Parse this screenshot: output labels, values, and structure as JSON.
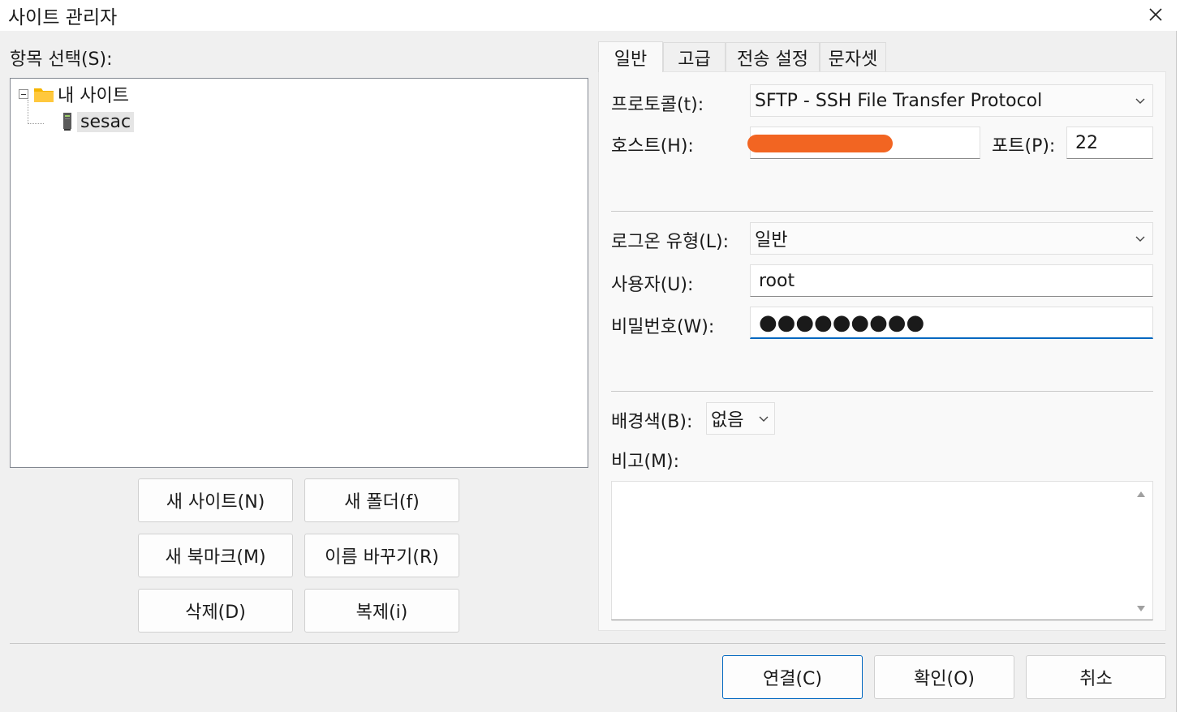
{
  "window": {
    "title": "사이트 관리자"
  },
  "left": {
    "section_label": "항목 선택(S):",
    "tree": {
      "root_label": "내 사이트",
      "children": [
        "sesac"
      ]
    },
    "buttons": {
      "new_site": "새 사이트(N)",
      "new_folder": "새 폴더(f)",
      "new_bookmark": "새 북마크(M)",
      "rename": "이름 바꾸기(R)",
      "delete": "삭제(D)",
      "duplicate": "복제(i)"
    }
  },
  "tabs": [
    "일반",
    "고급",
    "전송 설정",
    "문자셋"
  ],
  "active_tab": "일반",
  "general": {
    "protocol_label": "프로토콜(t):",
    "protocol_value": "SFTP - SSH File Transfer Protocol",
    "host_label": "호스트(H):",
    "host_value": "",
    "port_label": "포트(P):",
    "port_value": "22",
    "logon_type_label": "로그온 유형(L):",
    "logon_type_value": "일반",
    "user_label": "사용자(U):",
    "user_value": "root",
    "password_label": "비밀번호(W):",
    "password_mask": "●●●●●●●●●",
    "bg_color_label": "배경색(B):",
    "bg_color_value": "없음",
    "comment_label": "비고(M):",
    "comment_value": ""
  },
  "footer": {
    "connect": "연결(C)",
    "ok": "확인(O)",
    "cancel": "취소"
  },
  "colors": {
    "accent": "#0067c0",
    "redaction": "#f26522",
    "folder": "#f5b400"
  }
}
